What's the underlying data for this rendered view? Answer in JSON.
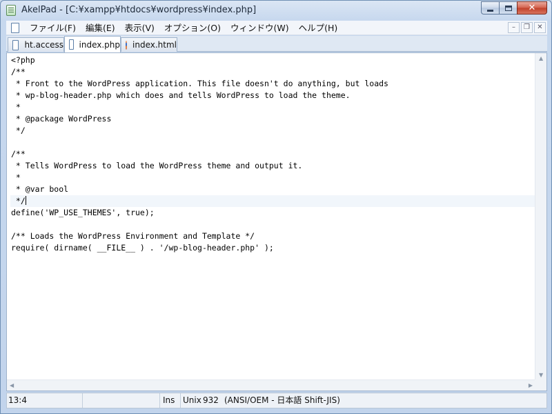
{
  "window": {
    "title": "AkelPad - [C:¥xampp¥htdocs¥wordpress¥index.php]"
  },
  "menu": {
    "items": [
      {
        "label": "ファイル(F)"
      },
      {
        "label": "編集(E)"
      },
      {
        "label": "表示(V)"
      },
      {
        "label": "オプション(O)"
      },
      {
        "label": "ウィンドウ(W)"
      },
      {
        "label": "ヘルプ(H)"
      }
    ]
  },
  "tabs": [
    {
      "label": "ht.access",
      "icon": "document-icon",
      "active": false
    },
    {
      "label": "index.php",
      "icon": "document-icon",
      "active": true
    },
    {
      "label": "index.html",
      "icon": "firefox-icon",
      "active": false
    }
  ],
  "editor": {
    "lines": [
      "<?php",
      "/**",
      " * Front to the WordPress application. This file doesn't do anything, but loads",
      " * wp-blog-header.php which does and tells WordPress to load the theme.",
      " *",
      " * @package WordPress",
      " */",
      "",
      "/**",
      " * Tells WordPress to load the WordPress theme and output it.",
      " *",
      " * @var bool",
      " */",
      "define('WP_USE_THEMES', true);",
      "",
      "/** Loads the WordPress Environment and Template */",
      "require( dirname( __FILE__ ) . '/wp-blog-header.php' );"
    ],
    "current_line": 13
  },
  "statusbar": {
    "position": "13:4",
    "insert_mode": "Ins",
    "newline": "Unix",
    "codepage": "932",
    "encoding": "(ANSI/OEM - 日本語 Shift-JIS)"
  },
  "colors": {
    "current_line_bg": "#f1f6fb"
  }
}
